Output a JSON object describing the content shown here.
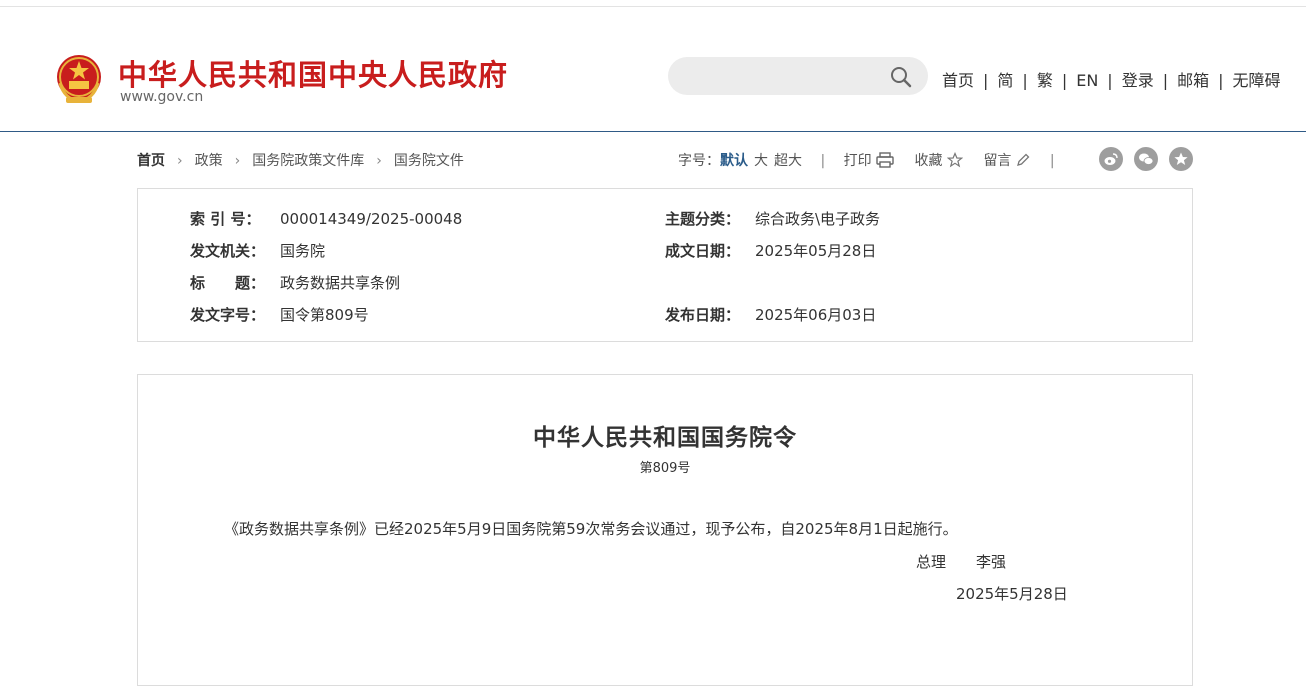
{
  "site": {
    "title": "中华人民共和国中央人民政府",
    "domain": "www.gov.cn"
  },
  "search": {
    "placeholder": ""
  },
  "topnav": [
    "首页",
    "简",
    "繁",
    "EN",
    "登录",
    "邮箱",
    "无障碍"
  ],
  "breadcrumb": [
    "首页",
    "政策",
    "国务院政策文件库",
    "国务院文件"
  ],
  "tools": {
    "font_label": "字号：",
    "font_default": "默认",
    "font_large": "大",
    "font_xlarge": "超大",
    "print": "打印",
    "favorite": "收藏",
    "comment": "留言"
  },
  "info": {
    "index_label": "索 引 号：",
    "index_value": "000014349/2025-00048",
    "topic_label": "主题分类：",
    "topic_value": "综合政务\\电子政务",
    "issuer_label": "发文机关：",
    "issuer_value": "国务院",
    "created_label": "成文日期：",
    "created_value": "2025年05月28日",
    "title_label": "标　　题：",
    "title_value": "政务数据共享条例",
    "docno_label": "发文字号：",
    "docno_value": "国令第809号",
    "published_label": "发布日期：",
    "published_value": "2025年06月03日"
  },
  "document": {
    "heading": "中华人民共和国国务院令",
    "number": "第809号",
    "body": "《政务数据共享条例》已经2025年5月9日国务院第59次常务会议通过，现予公布，自2025年8月1日起施行。",
    "signer_title": "总理",
    "signer_name": "李强",
    "date": "2025年5月28日"
  },
  "colors": {
    "brand_red": "#c81d1d",
    "header_border": "#2f5a86",
    "active_font": "#2b5c8a",
    "share_icon_bg": "#9e9e9e"
  }
}
